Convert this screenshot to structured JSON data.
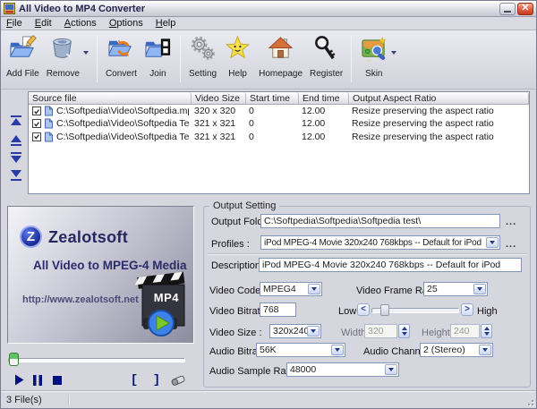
{
  "window": {
    "title": "All Video to MP4 Converter"
  },
  "menu": {
    "items": [
      "File",
      "Edit",
      "Actions",
      "Options",
      "Help"
    ]
  },
  "toolbar": {
    "buttons": [
      {
        "label": "Add File",
        "icon": "add-file-folder-icon",
        "dropdown": false,
        "group_start": false
      },
      {
        "label": "Remove",
        "icon": "remove-trash-icon",
        "dropdown": true,
        "group_start": false
      },
      {
        "label": "Convert",
        "icon": "convert-folder-icon",
        "dropdown": false,
        "group_start": true
      },
      {
        "label": "Join",
        "icon": "join-folder-icon",
        "dropdown": false,
        "group_start": false
      },
      {
        "label": "Setting",
        "icon": "setting-gears-icon",
        "dropdown": false,
        "group_start": true
      },
      {
        "label": "Help",
        "icon": "help-star-icon",
        "dropdown": false,
        "group_start": false
      },
      {
        "label": "Homepage",
        "icon": "homepage-house-icon",
        "dropdown": false,
        "group_start": false
      },
      {
        "label": "Register",
        "icon": "register-key-icon",
        "dropdown": false,
        "group_start": false
      },
      {
        "label": "Skin",
        "icon": "skin-picture-icon",
        "dropdown": true,
        "group_start": true
      }
    ]
  },
  "list_nav": {
    "buttons": [
      "move-to-top",
      "move-up",
      "move-down",
      "move-to-bottom"
    ]
  },
  "file_list": {
    "columns": [
      "Source file",
      "Video Size",
      "Start time",
      "End time",
      "Output Aspect Ratio"
    ],
    "rows": [
      {
        "checked": true,
        "source": "C:\\Softpedia\\Video\\Softpedia.mpeg",
        "video_size": "320 x 320",
        "start_time": "0",
        "end_time": "12.00",
        "aspect_ratio": "Resize preserving the aspect ratio"
      },
      {
        "checked": true,
        "source": "C:\\Softpedia\\Video\\Softpedia Teste...",
        "video_size": "321 x 321",
        "start_time": "0",
        "end_time": "12.00",
        "aspect_ratio": "Resize preserving the aspect ratio"
      },
      {
        "checked": true,
        "source": "C:\\Softpedia\\Video\\Softpedia Teste...",
        "video_size": "321 x 321",
        "start_time": "0",
        "end_time": "12.00",
        "aspect_ratio": "Resize preserving the aspect ratio"
      }
    ]
  },
  "preview": {
    "logo_letter": "Z",
    "brand": "Zealotsoft",
    "tagline": "All Video to MPEG-4 Media",
    "url": "http://www.zealotsoft.net",
    "badge": "MP4",
    "controls": [
      "play",
      "pause",
      "stop",
      "mark-start",
      "mark-end",
      "clear"
    ]
  },
  "output_setting": {
    "group_label": "Output Setting",
    "output_folder_label": "Output Folder:",
    "output_folder_value": "C:\\Softpedia\\Softpedia\\Softpedia test\\",
    "browse_label": "...",
    "profiles_label": "Profiles :",
    "profiles_value": "iPod MPEG-4 Movie 320x240 768kbps -- Default for iPod",
    "description_label": "Description :",
    "description_value": "iPod MPEG-4 Movie 320x240 768kbps -- Default for iPod",
    "video_codec_label": "Video Codec :",
    "video_codec_value": "MPEG4",
    "video_frame_rate_label": "Video Frame Rate :",
    "video_frame_rate_value": "25",
    "video_bitrate_label": "Video Bitrate:",
    "video_bitrate_value": "768",
    "low_label": "Low",
    "high_label": "High",
    "video_size_label": "Video Size :",
    "video_size_value": "320x240",
    "width_label": "Width :",
    "width_value": "320",
    "height_label": "Height :",
    "height_value": "240",
    "audio_bitrate_label": "Audio Bitrate :",
    "audio_bitrate_value": "56K",
    "audio_channels_label": "Audio Channels :",
    "audio_channels_value": "2 (Stereo)",
    "audio_sample_rate_label": "Audio Sample Rate :",
    "audio_sample_rate_value": "48000"
  },
  "status_bar": {
    "text": "3 File(s)"
  }
}
